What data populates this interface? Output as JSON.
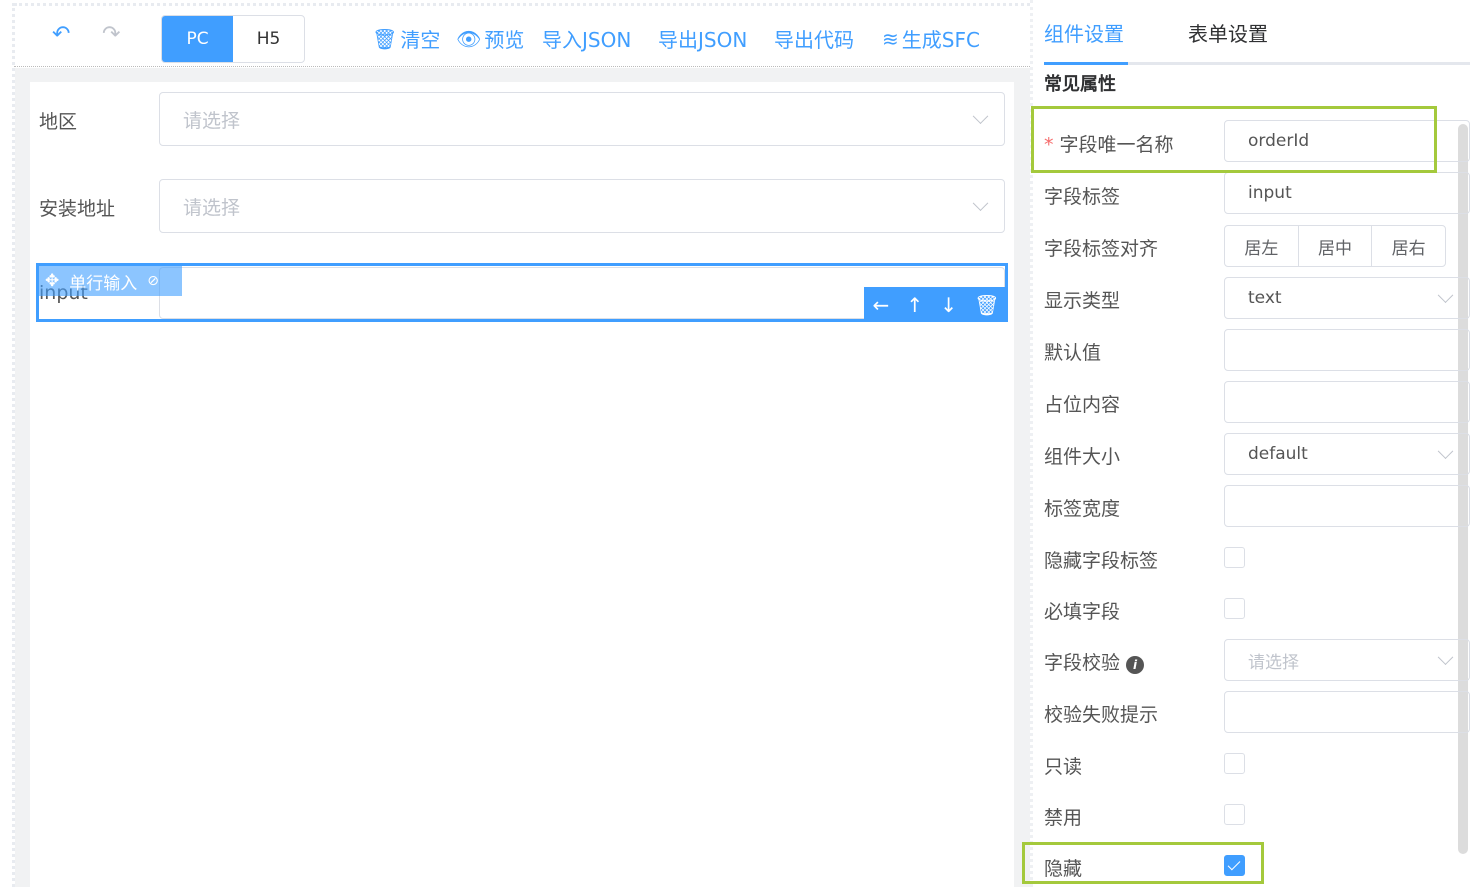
{
  "toolbar": {
    "undo_icon": "undo-icon",
    "redo_icon": "redo-icon",
    "device": {
      "pc": "PC",
      "h5": "H5",
      "selected": "PC"
    },
    "actions": [
      {
        "icon": "trash-icon",
        "label": "清空"
      },
      {
        "icon": "eye-icon",
        "label": "预览"
      },
      {
        "label": "导入JSON"
      },
      {
        "label": "导出JSON"
      },
      {
        "label": "导出代码"
      },
      {
        "icon": "layers-icon",
        "label": "生成SFC"
      }
    ]
  },
  "form": {
    "fields": [
      {
        "label": "地区",
        "placeholder": "请选择"
      },
      {
        "label": "安装地址",
        "placeholder": "请选择"
      },
      {
        "label": "input",
        "widget_name": "单行输入"
      }
    ]
  },
  "panel": {
    "tabs": [
      "组件设置",
      "表单设置"
    ],
    "active_tab": "组件设置",
    "section": "常见属性",
    "rows": [
      {
        "label": "字段唯一名称",
        "required": "*",
        "value": "orderId"
      },
      {
        "label": "字段标签",
        "value": "input"
      },
      {
        "label": "字段标签对齐",
        "options": [
          "居左",
          "居中",
          "居右"
        ]
      },
      {
        "label": "显示类型",
        "value": "text"
      },
      {
        "label": "默认值",
        "value": ""
      },
      {
        "label": "占位内容",
        "value": ""
      },
      {
        "label": "组件大小",
        "value": "default"
      },
      {
        "label": "标签宽度",
        "value": ""
      },
      {
        "label": "隐藏字段标签",
        "checked": false
      },
      {
        "label": "必填字段",
        "checked": false
      },
      {
        "label": "字段校验",
        "placeholder": "请选择"
      },
      {
        "label": "校验失败提示",
        "value": ""
      },
      {
        "label": "只读",
        "checked": false
      },
      {
        "label": "禁用",
        "checked": false
      },
      {
        "label": "隐藏",
        "checked": true
      }
    ]
  },
  "colors": {
    "primary": "#409eff",
    "highlight": "#a4c93c"
  }
}
